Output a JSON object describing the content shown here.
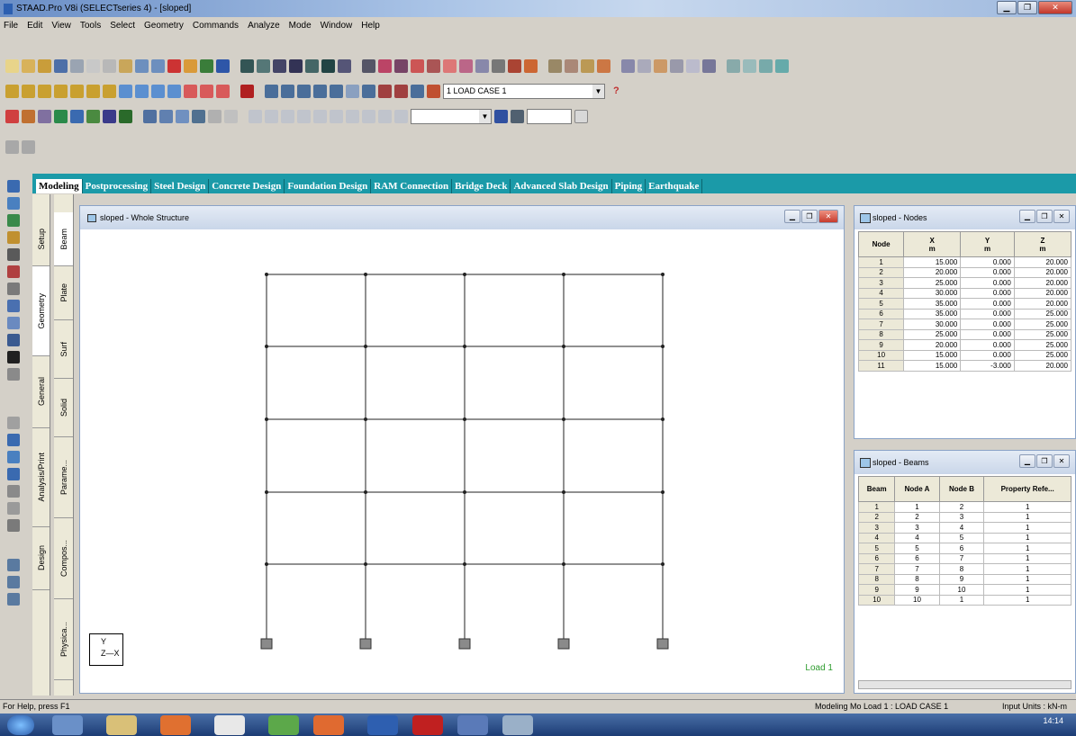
{
  "window": {
    "title": "STAAD.Pro V8i (SELECTseries 4) - [sloped]"
  },
  "menu": [
    "File",
    "Edit",
    "View",
    "Tools",
    "Select",
    "Geometry",
    "Commands",
    "Analyze",
    "Mode",
    "Window",
    "Help"
  ],
  "toolbar": {
    "load_case": "1 LOAD CASE 1",
    "help_glyph": "?"
  },
  "page_tabs": [
    "Modeling",
    "Postprocessing",
    "Steel Design",
    "Concrete Design",
    "Foundation Design",
    "RAM Connection",
    "Bridge Deck",
    "Advanced Slab Design",
    "Piping",
    "Earthquake"
  ],
  "vtabs_outer": [
    "Setup",
    "Geometry",
    "General",
    "Analysis/Print",
    "Design"
  ],
  "vtabs_inner": [
    "Beam",
    "Plate",
    "Surf",
    "Solid",
    "Parame...",
    "Compos...",
    "Physica..."
  ],
  "viewport": {
    "title": "sloped - Whole Structure",
    "load_label": "Load 1",
    "axis_y": "Y",
    "axis_zx": "Z—X"
  },
  "nodes_table": {
    "title": "sloped - Nodes",
    "headers": [
      "Node",
      "X\nm",
      "Y\nm",
      "Z\nm"
    ],
    "rows": [
      [
        "1",
        "15.000",
        "0.000",
        "20.000"
      ],
      [
        "2",
        "20.000",
        "0.000",
        "20.000"
      ],
      [
        "3",
        "25.000",
        "0.000",
        "20.000"
      ],
      [
        "4",
        "30.000",
        "0.000",
        "20.000"
      ],
      [
        "5",
        "35.000",
        "0.000",
        "20.000"
      ],
      [
        "6",
        "35.000",
        "0.000",
        "25.000"
      ],
      [
        "7",
        "30.000",
        "0.000",
        "25.000"
      ],
      [
        "8",
        "25.000",
        "0.000",
        "25.000"
      ],
      [
        "9",
        "20.000",
        "0.000",
        "25.000"
      ],
      [
        "10",
        "15.000",
        "0.000",
        "25.000"
      ],
      [
        "11",
        "15.000",
        "-3.000",
        "20.000"
      ]
    ]
  },
  "beams_table": {
    "title": "sloped - Beams",
    "headers": [
      "Beam",
      "Node A",
      "Node B",
      "Property Refe..."
    ],
    "rows": [
      [
        "1",
        "1",
        "2",
        "1"
      ],
      [
        "2",
        "2",
        "3",
        "1"
      ],
      [
        "3",
        "3",
        "4",
        "1"
      ],
      [
        "4",
        "4",
        "5",
        "1"
      ],
      [
        "5",
        "5",
        "6",
        "1"
      ],
      [
        "6",
        "6",
        "7",
        "1"
      ],
      [
        "7",
        "7",
        "8",
        "1"
      ],
      [
        "8",
        "8",
        "9",
        "1"
      ],
      [
        "9",
        "9",
        "10",
        "1"
      ],
      [
        "10",
        "10",
        "1",
        "1"
      ]
    ]
  },
  "status": {
    "help": "For Help, press F1",
    "mode": "Modeling Mo Load 1 : LOAD CASE 1",
    "units": "Input Units : kN-m"
  },
  "taskbar": {
    "time": "14:14"
  },
  "colors": {
    "tab_bar": "#1b9aa8",
    "load_text": "#2e9c2e"
  }
}
